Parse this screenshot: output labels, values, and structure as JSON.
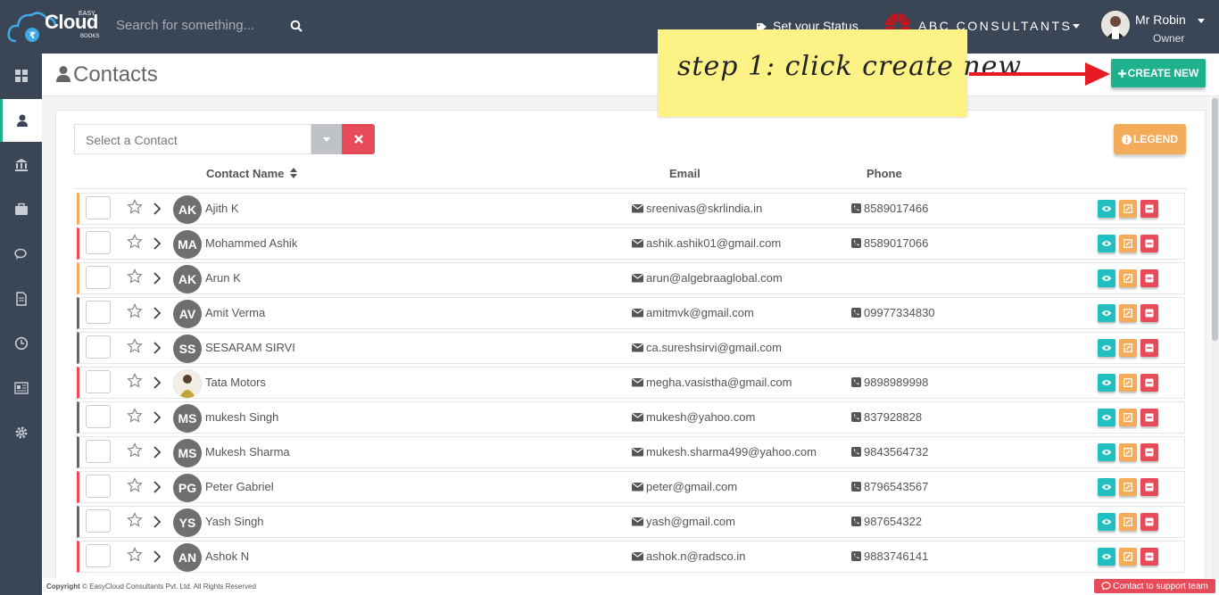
{
  "app": {
    "logo_small": "EASY",
    "logo_main": "Cloud",
    "logo_sub": "BOOKS"
  },
  "topbar": {
    "search_placeholder": "Search for something...",
    "status_label": "Set your Status",
    "company_name": "ABC CONSULTANTS",
    "user_name": "Mr Robin",
    "user_role": "Owner"
  },
  "page": {
    "title": "Contacts",
    "create_button": "CREATE NEW",
    "annotation": "step 1: click create new"
  },
  "filter": {
    "select_placeholder": "Select a Contact",
    "legend_button": "LEGEND"
  },
  "table": {
    "columns": [
      "Contact Name",
      "Email",
      "Phone"
    ],
    "rows": [
      {
        "initials": "AK",
        "name": "Ajith K",
        "email": "sreenivas@skrlindia.in",
        "phone": "8589017466",
        "color": "#f4ac5a"
      },
      {
        "initials": "MA",
        "name": "Mohammed Ashik",
        "email": "ashik.ashik01@gmail.com",
        "phone": "8589017066",
        "color": "#e74b5a"
      },
      {
        "initials": "AK",
        "name": "Arun K",
        "email": "arun@algebraaglobal.com",
        "phone": "",
        "color": "#f4ac5a"
      },
      {
        "initials": "AV",
        "name": "Amit Verma",
        "email": "amitmvk@gmail.com",
        "phone": "09977334830",
        "color": "#666666"
      },
      {
        "initials": "SS",
        "name": "SESARAM SIRVI",
        "email": "ca.sureshsirvi@gmail.com",
        "phone": "",
        "color": "#666666"
      },
      {
        "initials": "",
        "name": "Tata Motors",
        "email": "megha.vasistha@gmail.com",
        "phone": "9898989998",
        "color": "#e74b5a"
      },
      {
        "initials": "MS",
        "name": "mukesh Singh",
        "email": "mukesh@yahoo.com",
        "phone": "837928828",
        "color": "#666666"
      },
      {
        "initials": "MS",
        "name": "Mukesh Sharma",
        "email": "mukesh.sharma499@yahoo.com",
        "phone": "9843564732",
        "color": "#666666"
      },
      {
        "initials": "PG",
        "name": "Peter Gabriel",
        "email": "peter@gmail.com",
        "phone": "8796543567",
        "color": "#e74b5a"
      },
      {
        "initials": "YS",
        "name": "Yash Singh",
        "email": "yash@gmail.com",
        "phone": "987654322",
        "color": "#666666"
      },
      {
        "initials": "AN",
        "name": "Ashok N",
        "email": "ashok.n@radsco.in",
        "phone": "9883746141",
        "color": "#e74b5a"
      }
    ]
  },
  "footer": {
    "copyright_bold": "Copyright",
    "copyright_text": "© EasyCloud Consultants Pvt. Ltd. All Rights Reserved",
    "support_button": "Contact to support team"
  },
  "sidebar": {
    "items": [
      "dashboard-icon",
      "contacts-icon",
      "bank-icon",
      "briefcase-icon",
      "chat-icon",
      "document-icon",
      "clock-icon",
      "report-icon",
      "settings-icon"
    ]
  },
  "colors": {
    "topbar": "#3a4555",
    "accent": "#1fb08e",
    "danger": "#e74b5a",
    "warning": "#f4ac5a",
    "info": "#21bfc0",
    "note": "#fcf285"
  }
}
